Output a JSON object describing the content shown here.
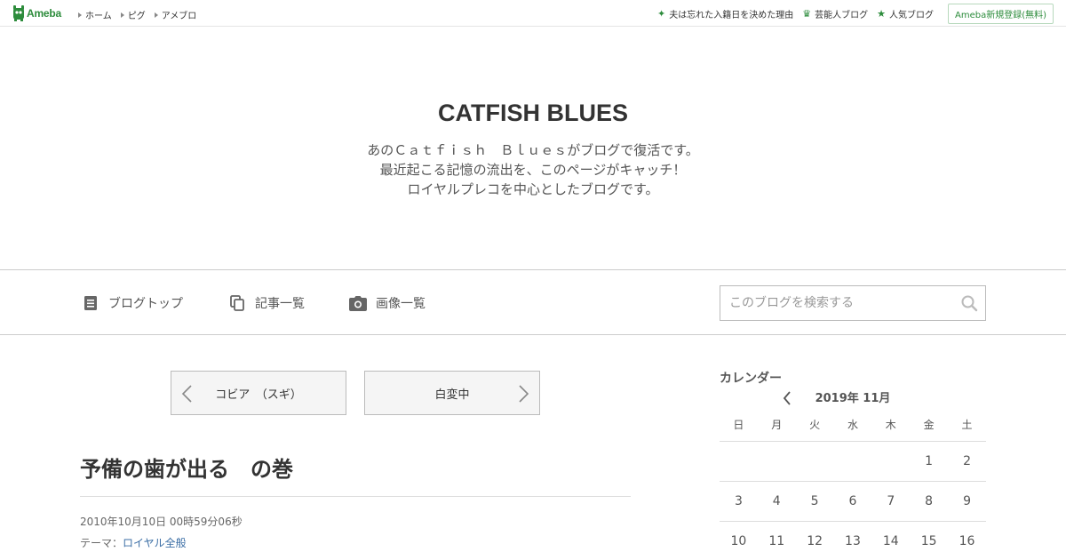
{
  "topbar": {
    "logo_text": "Ameba",
    "nav": [
      "ホーム",
      "ピグ",
      "アメブロ"
    ],
    "right_links": [
      {
        "icon": "sparkle-icon",
        "label": "夫は忘れた入籍日を決めた理由"
      },
      {
        "icon": "crown-icon",
        "label": "芸能人ブログ"
      },
      {
        "icon": "star-icon",
        "label": "人気ブログ"
      }
    ],
    "signup_label": "Ameba新規登録(無料)"
  },
  "header": {
    "title": "CATFISH BLUES",
    "description": [
      "あのＣａｔｆｉｓｈ　Ｂｌｕｅｓがブログで復活です。",
      "最近起こる記憶の流出を、このページがキャッチ！",
      "ロイヤルプレコを中心としたブログです。"
    ]
  },
  "blognav": {
    "items": [
      {
        "icon": "document-icon",
        "label": "ブログトップ"
      },
      {
        "icon": "copy-icon",
        "label": "記事一覧"
      },
      {
        "icon": "camera-icon",
        "label": "画像一覧"
      }
    ],
    "search_placeholder": "このブログを検索する"
  },
  "pager": {
    "prev_label": "コビア　（スギ）",
    "next_label": "白変中"
  },
  "entry": {
    "title": "予備の歯が出る　の巻",
    "date": "2010年10月10日 00時59分06秒",
    "theme_prefix": "テーマ：",
    "theme_link": "ロイヤル全般"
  },
  "calendar": {
    "heading": "カレンダー",
    "month": "2019年 11月",
    "weekdays": [
      "日",
      "月",
      "火",
      "水",
      "木",
      "金",
      "土"
    ],
    "rows": [
      [
        "",
        "",
        "",
        "",
        "",
        "1",
        "2"
      ],
      [
        "3",
        "4",
        "5",
        "6",
        "7",
        "8",
        "9"
      ],
      [
        "10",
        "11",
        "12",
        "13",
        "14",
        "15",
        "16"
      ]
    ]
  },
  "colors": {
    "brand_green": "#2d8c3c",
    "link_blue": "#3b6ea5"
  }
}
